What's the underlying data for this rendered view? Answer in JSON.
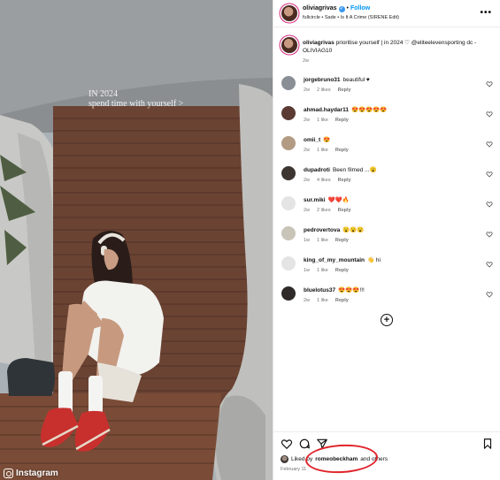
{
  "photo": {
    "overlay_line1": "IN 2024",
    "overlay_line2": "spend time with yourself >",
    "watermark": "Instagram"
  },
  "header": {
    "username": "oliviagrivas",
    "follow_label": "Follow",
    "dot": "•",
    "audio": "fullcircle • Sade • Is It A Crime (SIRENE Edit)",
    "more": "•••"
  },
  "caption": {
    "username": "oliviagrivas",
    "text": "prioritise yourself | in 2024 ♡ @eliteelevensporting dc - OLIVIAG10",
    "time": "2w"
  },
  "comments": [
    {
      "user": "jorgebruno31",
      "text": "beautiful ♥",
      "time": "2w",
      "likes": "2 likes",
      "reply": "Reply",
      "avatar_color": "#8a8f96"
    },
    {
      "user": "ahmad.haydar11",
      "text": "😍😍😍😍😍",
      "time": "2w",
      "likes": "1 like",
      "reply": "Reply",
      "avatar_color": "#5a3a33"
    },
    {
      "user": "omii_t",
      "text": "😍",
      "time": "2w",
      "likes": "1 like",
      "reply": "Reply",
      "avatar_color": "#b39a82"
    },
    {
      "user": "dupadroti",
      "text": "Been filmed ...😮",
      "time": "2w",
      "likes": "4 likes",
      "reply": "Reply",
      "avatar_color": "#3b3430"
    },
    {
      "user": "sur.miki",
      "text": "❤️❤️🔥",
      "time": "2w",
      "likes": "2 likes",
      "reply": "Reply",
      "avatar_color": "#e4e4e4"
    },
    {
      "user": "pedrovertova",
      "text": "😮😮😮",
      "time": "1w",
      "likes": "1 like",
      "reply": "Reply",
      "avatar_color": "#c9c4b8"
    },
    {
      "user": "king_of_my_mountain",
      "text": "👋 hi",
      "time": "1w",
      "likes": "1 like",
      "reply": "Reply",
      "avatar_color": "#e4e4e4"
    },
    {
      "user": "bluelotus37",
      "text": "😍😍😍!!!",
      "time": "2w",
      "likes": "1 like",
      "reply": "Reply",
      "avatar_color": "#2f2a28"
    }
  ],
  "load_more_symbol": "+",
  "likes": {
    "prefix": "Liked by",
    "user": "romeobeckham",
    "suffix": "and others"
  },
  "date": "February 11",
  "colors": {
    "follow": "#0095f6",
    "annotation": "#e0242b",
    "meta_gray": "#737373"
  },
  "icons": [
    "heart-icon",
    "comment-icon",
    "share-icon",
    "bookmark-icon",
    "add-circle-icon",
    "more-icon",
    "verified-icon"
  ]
}
